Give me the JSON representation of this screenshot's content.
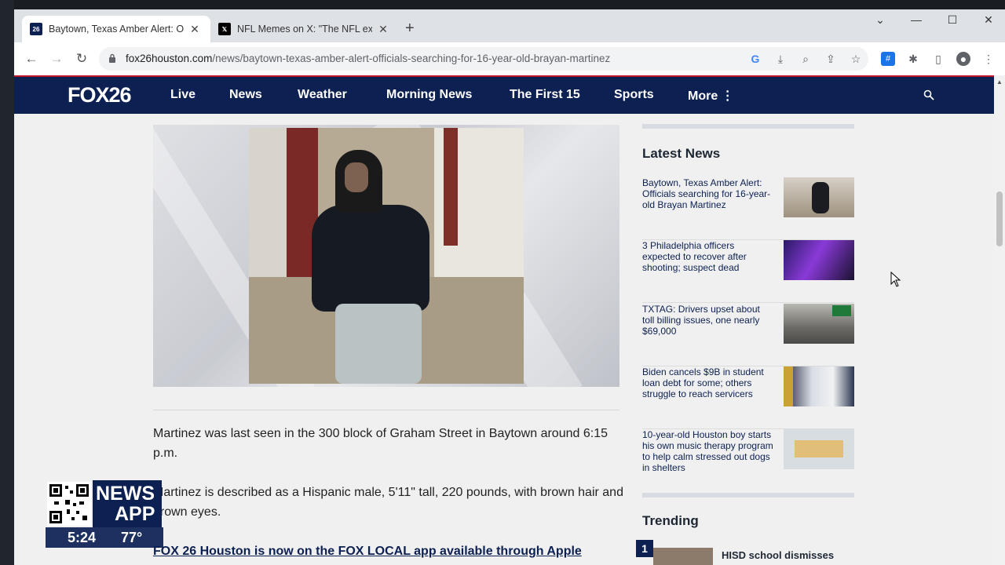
{
  "browser": {
    "tabs": [
      {
        "title": "Baytown, Texas Amber Alert: Offi",
        "favicon": "fox26-favicon",
        "active": true
      },
      {
        "title": "NFL Memes on X: \"The NFL explo",
        "favicon": "x-favicon",
        "active": false
      }
    ],
    "url_host": "fox26houston.com",
    "url_path": "/news/baytown-texas-amber-alert-officials-searching-for-16-year-old-brayan-martinez"
  },
  "site": {
    "logo": "FOX26",
    "nav": [
      "Live",
      "News",
      "Weather",
      "Morning News",
      "The First 15",
      "Sports",
      "More ⋮"
    ]
  },
  "article": {
    "paragraphs": [
      "Martinez was last seen in the 300 block of Graham Street in Baytown around 6:15 p.m.",
      "Martinez is described as a Hispanic male, 5'11\" tall, 220 pounds, with brown hair and brown eyes."
    ],
    "link_text": "FOX 26 Houston is now on the FOX LOCAL app available through Apple"
  },
  "sidebar": {
    "latest_heading": "Latest News",
    "latest": [
      {
        "headline": "Baytown, Texas Amber Alert: Officials searching for 16-year-old Brayan Martinez"
      },
      {
        "headline": "3 Philadelphia officers expected to recover after shooting; suspect dead"
      },
      {
        "headline": "TXTAG: Drivers upset about toll billing issues, one nearly $69,000"
      },
      {
        "headline": "Biden cancels $9B in student loan debt for some; others struggle to reach servicers"
      },
      {
        "headline": "10-year-old Houston boy starts his own music therapy program to help calm stressed out dogs in shelters"
      }
    ],
    "trending_heading": "Trending",
    "trending": [
      {
        "rank": "1",
        "headline": "HISD school dismisses"
      }
    ]
  },
  "tv_overlay": {
    "line1": "NEWS",
    "line2": "APP",
    "time": "5:24",
    "temperature": "77°"
  },
  "colors": {
    "nav_bg": "#0c2052",
    "accent_red": "#c0162a"
  }
}
